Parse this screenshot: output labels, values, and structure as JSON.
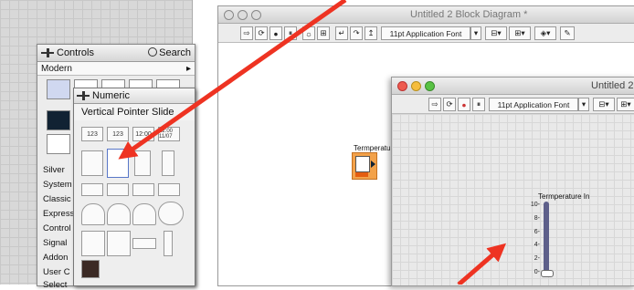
{
  "controls_palette": {
    "title": "Controls",
    "search_label": "Search",
    "modern_label": "Modern",
    "categories": [
      "Silver",
      "System",
      "Classic",
      "Express",
      "Control",
      "Signal",
      "Addon",
      "User C",
      "Select"
    ]
  },
  "numeric_palette": {
    "title": "Numeric",
    "tooltip": "Vertical Pointer Slide",
    "icon_labels": [
      "123",
      "123",
      "12:00",
      "12:00 11/07"
    ]
  },
  "block_diagram": {
    "title": "Untitled 2 Block Diagram *",
    "font_label": "11pt Application Font",
    "terminal_label": "Termperatu"
  },
  "front_panel": {
    "title": "Untitled 2",
    "font_label": "11pt Application Font",
    "slider": {
      "label": "Termperature In",
      "ticks": [
        "10-",
        "8-",
        "6-",
        "4-",
        "2-",
        "0-"
      ],
      "value": 0,
      "min": 0,
      "max": 10
    }
  },
  "colors": {
    "arrow": "#ee3322",
    "slider": "#5d5f8a"
  }
}
